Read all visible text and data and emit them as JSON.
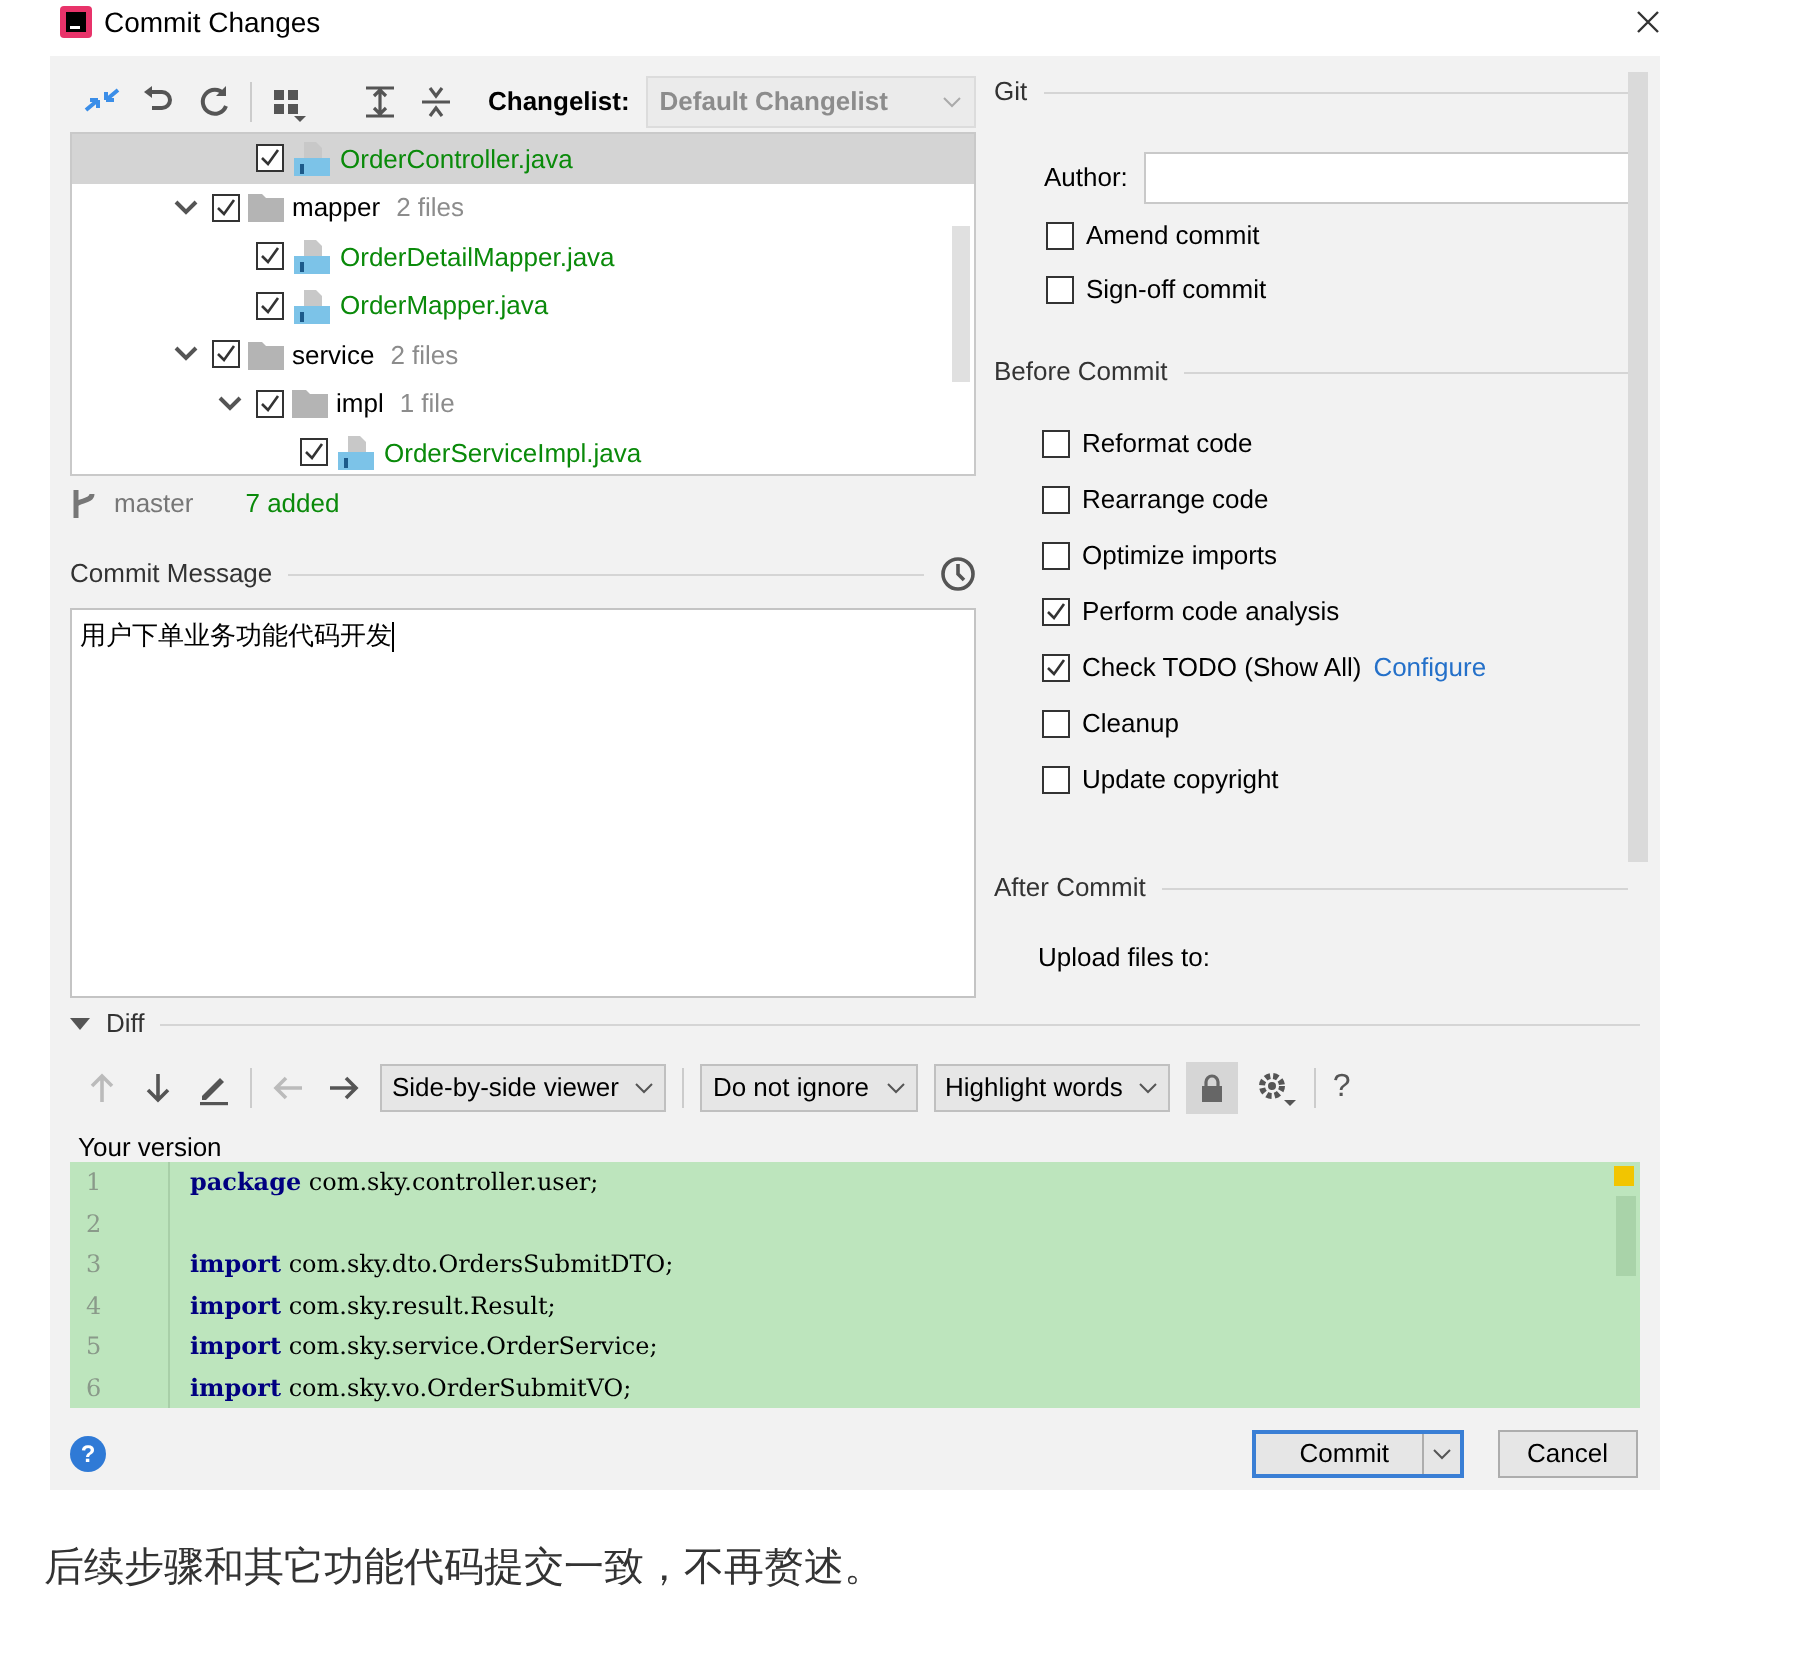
{
  "window": {
    "title": "Commit Changes"
  },
  "toolbar": {
    "changelist_label": "Changelist:",
    "changelist": "Default Changelist"
  },
  "tree": {
    "items": [
      {
        "children": [
          {
            "kind": "file",
            "label": "OrderController.java",
            "checked": true,
            "selected": true
          }
        ]
      },
      {
        "kind": "folder",
        "label": "mapper",
        "count": "2 files",
        "checked": true,
        "expanded": true,
        "selected": false,
        "children": [
          {
            "kind": "file",
            "label": "OrderDetailMapper.java",
            "checked": true,
            "selected": false
          },
          {
            "kind": "file",
            "label": "OrderMapper.java",
            "checked": true,
            "selected": false
          }
        ]
      },
      {
        "kind": "folder",
        "label": "service",
        "count": "2 files",
        "checked": true,
        "expanded": true,
        "selected": false,
        "children": [
          {
            "kind": "folder",
            "label": "impl",
            "count": "1 file",
            "checked": true,
            "expanded": true,
            "selected": false,
            "children": [
              {
                "kind": "file",
                "label": "OrderServiceImpl.java",
                "checked": true,
                "selected": false
              }
            ]
          }
        ]
      }
    ]
  },
  "branch": {
    "name": "master",
    "summary": "7 added"
  },
  "commit_message": {
    "label": "Commit Message",
    "value": "用户下单业务功能代码开发"
  },
  "git": {
    "title": "Git",
    "author_label": "Author:",
    "options": [
      {
        "label": "Amend commit",
        "checked": false
      },
      {
        "label": "Sign-off commit",
        "checked": false
      }
    ]
  },
  "before_commit": {
    "title": "Before Commit",
    "options": [
      {
        "label": "Reformat code",
        "checked": false
      },
      {
        "label": "Rearrange code",
        "checked": false
      },
      {
        "label": "Optimize imports",
        "checked": false
      },
      {
        "label": "Perform code analysis",
        "checked": true
      },
      {
        "label": "Check TODO (Show All)",
        "checked": true,
        "link": "Configure"
      },
      {
        "label": "Cleanup",
        "checked": false
      },
      {
        "label": "Update copyright",
        "checked": false
      }
    ]
  },
  "after_commit": {
    "title": "After Commit",
    "upload_label": "Upload files to:"
  },
  "diff": {
    "title": "Diff",
    "expanded": true,
    "dropdowns": [
      "Side-by-side viewer",
      "Do not ignore",
      "Highlight words"
    ],
    "help": "?",
    "version_label": "Your version",
    "lines": [
      {
        "number": "1",
        "keyword": "package",
        "text": "com.sky.controller.user;"
      },
      {
        "number": "2"
      },
      {
        "number": "3",
        "keyword": "import",
        "text": "com.sky.dto.OrdersSubmitDTO;"
      },
      {
        "number": "4",
        "keyword": "import",
        "text": "com.sky.result.Result;"
      },
      {
        "number": "5",
        "keyword": "import",
        "text": "com.sky.service.OrderService;"
      },
      {
        "number": "6",
        "keyword": "import",
        "text": "com.sky.vo.OrderSubmitVO;"
      }
    ]
  },
  "footer": {
    "help": "?",
    "buttons": [
      {
        "label": "Commit",
        "kind": "primary"
      },
      {
        "label": "Cancel",
        "kind": "plain"
      }
    ]
  },
  "caption": "后续步骤和其它功能代码提交一致，不再赘述。"
}
